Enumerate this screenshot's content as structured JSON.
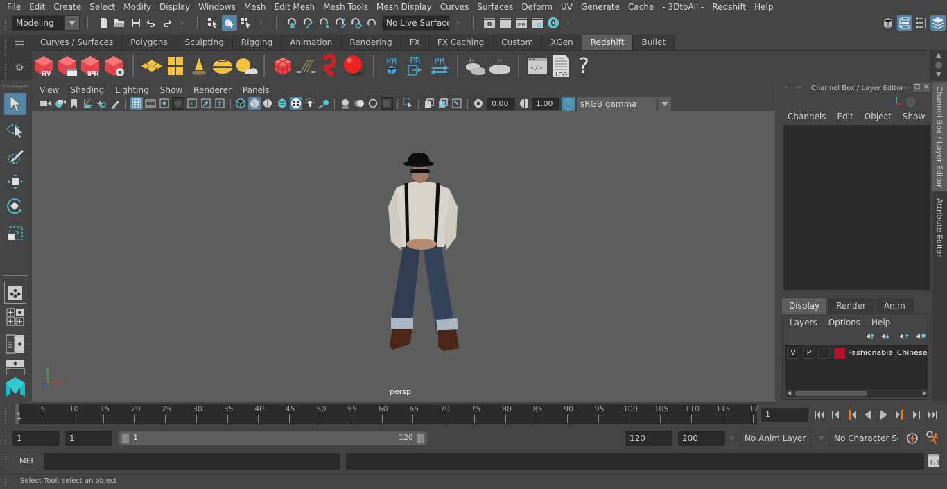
{
  "menubar": {
    "items": [
      "File",
      "Edit",
      "Create",
      "Select",
      "Modify",
      "Display",
      "Windows",
      "Mesh",
      "Edit Mesh",
      "Mesh Tools",
      "Mesh Display",
      "Curves",
      "Surfaces",
      "Deform",
      "UV",
      "Generate",
      "Cache",
      "- 3DtoAll -",
      "Redshift",
      "Help"
    ]
  },
  "statusline": {
    "workspace": "Modeling",
    "live_surface": "No Live Surface",
    "icons": [
      "new-scene-icon",
      "open-scene-icon",
      "save-scene-icon",
      "undo-icon",
      "redo-icon",
      "select-by-hierarchy-icon",
      "select-by-object-icon",
      "select-by-component-icon",
      "snap-grid-icon",
      "snap-curve-icon",
      "snap-point-icon",
      "snap-view-plane-icon",
      "snap-live-icon",
      "make-live-icon",
      "render-view-icon",
      "render-current-icon",
      "ipr-render-icon",
      "render-settings-icon",
      "hypershade-icon"
    ],
    "right_icons": [
      "modeling-toolkit-icon",
      "attribute-editor-toggle-icon",
      "tool-settings-icon",
      "channel-box-toggle-icon"
    ]
  },
  "shelf": {
    "tabs": [
      "Curves / Surfaces",
      "Polygons",
      "Sculpting",
      "Rigging",
      "Animation",
      "Rendering",
      "FX",
      "FX Caching",
      "Custom",
      "XGen",
      "Redshift",
      "Bullet"
    ],
    "active_tab": "Redshift",
    "buttons": [
      {
        "name": "redshift-render-view",
        "label": "RV"
      },
      {
        "name": "redshift-batch-render",
        "label": ""
      },
      {
        "name": "redshift-ipr",
        "label": "IPR"
      },
      {
        "name": "redshift-render-settings",
        "label": ""
      },
      {
        "name": "redshift-area-light",
        "label": ""
      },
      {
        "name": "redshift-portal-light",
        "label": ""
      },
      {
        "name": "redshift-ies-light",
        "label": ""
      },
      {
        "name": "redshift-dome-light",
        "label": ""
      },
      {
        "name": "redshift-sun-sky",
        "label": ""
      },
      {
        "name": "redshift-volume",
        "label": ""
      },
      {
        "name": "redshift-hair",
        "label": ""
      },
      {
        "name": "redshift-mesh-light",
        "label": ""
      },
      {
        "name": "redshift-material-ball",
        "label": ""
      },
      {
        "name": "redshift-proxy-create",
        "label": "PR"
      },
      {
        "name": "redshift-proxy-export",
        "label": "PR"
      },
      {
        "name": "redshift-proxy-convert",
        "label": "PR"
      },
      {
        "name": "redshift-bake-multiple",
        "label": ""
      },
      {
        "name": "redshift-bake",
        "label": ""
      },
      {
        "name": "redshift-script-editor",
        "label": ""
      },
      {
        "name": "redshift-log",
        "label": ".LOG"
      },
      {
        "name": "redshift-help",
        "label": "?"
      }
    ]
  },
  "viewport": {
    "menus": [
      "View",
      "Shading",
      "Lighting",
      "Show",
      "Renderer",
      "Panels"
    ],
    "exposure": "0.00",
    "gamma": "1.00",
    "color_management": "ON",
    "color_space": "sRGB gamma",
    "camera_label": "persp",
    "axis": {
      "x": "x",
      "y": "y",
      "z": "z"
    }
  },
  "channel_box": {
    "title": "Channel Box / Layer Editor",
    "menus": [
      "Channels",
      "Edit",
      "Object",
      "Show"
    ],
    "layer_tabs": [
      "Display",
      "Render",
      "Anim"
    ],
    "active_layer_tab": "Display",
    "layer_menus": [
      "Layers",
      "Options",
      "Help"
    ],
    "layers": [
      {
        "visible": "V",
        "playback": "P",
        "color": "#b5122d",
        "name": "Fashionable_Chinese_"
      }
    ]
  },
  "side_tabs": [
    "Channel Box / Layer Editor",
    "Attribute Editor"
  ],
  "time_slider": {
    "current_frame_marker": "1",
    "tick_labels": [
      5,
      10,
      15,
      20,
      25,
      30,
      35,
      40,
      45,
      50,
      55,
      60,
      65,
      70,
      75,
      80,
      85,
      90,
      95,
      100,
      105,
      110,
      115,
      "12"
    ],
    "current_frame": "1"
  },
  "range_slider": {
    "start_time": "1",
    "playback_start": "1",
    "range_min_label": "1",
    "range_max_label": "120",
    "playback_end": "120",
    "end_time": "200",
    "anim_layer": "No Anim Layer",
    "character_set": "No Character Set"
  },
  "command_line": {
    "language": "MEL",
    "input": "",
    "result": ""
  },
  "help_line": {
    "text": "Select Tool: select an object"
  }
}
